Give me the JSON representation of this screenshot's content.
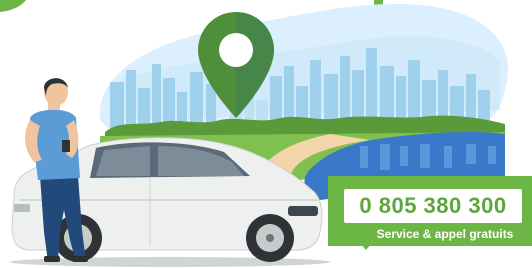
{
  "callout": {
    "phone_number": "0 805 380 300",
    "service_label": "Service & appel gratuits"
  },
  "colors": {
    "brand_green": "#6cb645",
    "sky_blue": "#8fc8e8",
    "water_blue": "#3a78c9",
    "pin_green": "#4f8f3a",
    "car_white": "#eef0ef"
  },
  "illustration": {
    "icons": [
      "map-pin-icon",
      "city-skyline",
      "car",
      "person-with-phone"
    ]
  }
}
